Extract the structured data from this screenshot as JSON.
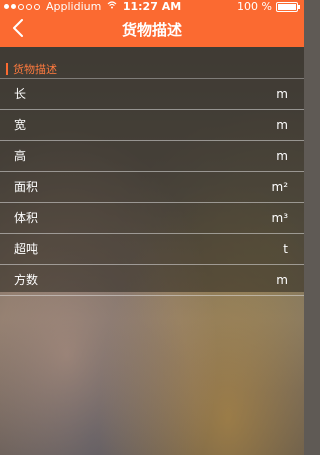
{
  "status_bar": {
    "carrier": "Applidium",
    "time": "11:27 AM",
    "battery": "100 %"
  },
  "nav": {
    "title": "货物描述",
    "back_icon": "chevron-left-icon"
  },
  "section": {
    "title": "货物描述"
  },
  "rows": [
    {
      "label": "长",
      "unit": "m"
    },
    {
      "label": "宽",
      "unit": "m"
    },
    {
      "label": "高",
      "unit": "m"
    },
    {
      "label": "面积",
      "unit": "m²"
    },
    {
      "label": "体积",
      "unit": "m³"
    },
    {
      "label": "超吨",
      "unit": "t"
    },
    {
      "label": "方数",
      "unit": "m"
    }
  ],
  "colors": {
    "accent": "#fb6a31"
  }
}
